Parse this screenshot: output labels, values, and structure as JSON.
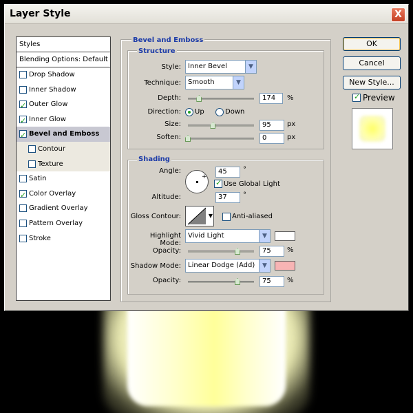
{
  "window": {
    "title": "Layer Style",
    "close_glyph": "X"
  },
  "sidebar": {
    "header": "Styles",
    "blending": "Blending Options: Default",
    "items": [
      {
        "label": "Drop Shadow",
        "checked": false
      },
      {
        "label": "Inner Shadow",
        "checked": false
      },
      {
        "label": "Outer Glow",
        "checked": true
      },
      {
        "label": "Inner Glow",
        "checked": true
      },
      {
        "label": "Bevel and Emboss",
        "checked": true,
        "selected": true
      },
      {
        "label": "Contour",
        "checked": false,
        "sub": true
      },
      {
        "label": "Texture",
        "checked": false,
        "sub": true
      },
      {
        "label": "Satin",
        "checked": false
      },
      {
        "label": "Color Overlay",
        "checked": true
      },
      {
        "label": "Gradient Overlay",
        "checked": false
      },
      {
        "label": "Pattern Overlay",
        "checked": false
      },
      {
        "label": "Stroke",
        "checked": false
      }
    ]
  },
  "bevel": {
    "section_title": "Bevel and Emboss",
    "structure_title": "Structure",
    "style_label": "Style:",
    "style_value": "Inner Bevel",
    "technique_label": "Technique:",
    "technique_value": "Smooth",
    "depth_label": "Depth:",
    "depth_value": "174",
    "depth_unit": "%",
    "direction_label": "Direction:",
    "direction_up": "Up",
    "direction_down": "Down",
    "size_label": "Size:",
    "size_value": "95",
    "size_unit": "px",
    "soften_label": "Soften:",
    "soften_value": "0",
    "soften_unit": "px"
  },
  "shading": {
    "title": "Shading",
    "angle_label": "Angle:",
    "angle_value": "45",
    "angle_unit": "°",
    "use_global_light": "Use Global Light",
    "altitude_label": "Altitude:",
    "altitude_value": "37",
    "altitude_unit": "°",
    "gloss_label": "Gloss Contour:",
    "anti_aliased": "Anti-aliased",
    "highlight_mode_label": "Highlight Mode:",
    "highlight_mode_value": "Vivid Light",
    "highlight_color": "#ffffff",
    "highlight_opacity_label": "Opacity:",
    "highlight_opacity_value": "75",
    "highlight_opacity_unit": "%",
    "shadow_mode_label": "Shadow Mode:",
    "shadow_mode_value": "Linear Dodge (Add)",
    "shadow_color": "#f8b4b4",
    "shadow_opacity_label": "Opacity:",
    "shadow_opacity_value": "75",
    "shadow_opacity_unit": "%"
  },
  "buttons": {
    "ok": "OK",
    "cancel": "Cancel",
    "new_style": "New Style...",
    "preview": "Preview"
  },
  "sliders": {
    "depth": 0.17,
    "size": 0.38,
    "soften": 0.0,
    "highlight_opacity": 0.75,
    "shadow_opacity": 0.75
  }
}
